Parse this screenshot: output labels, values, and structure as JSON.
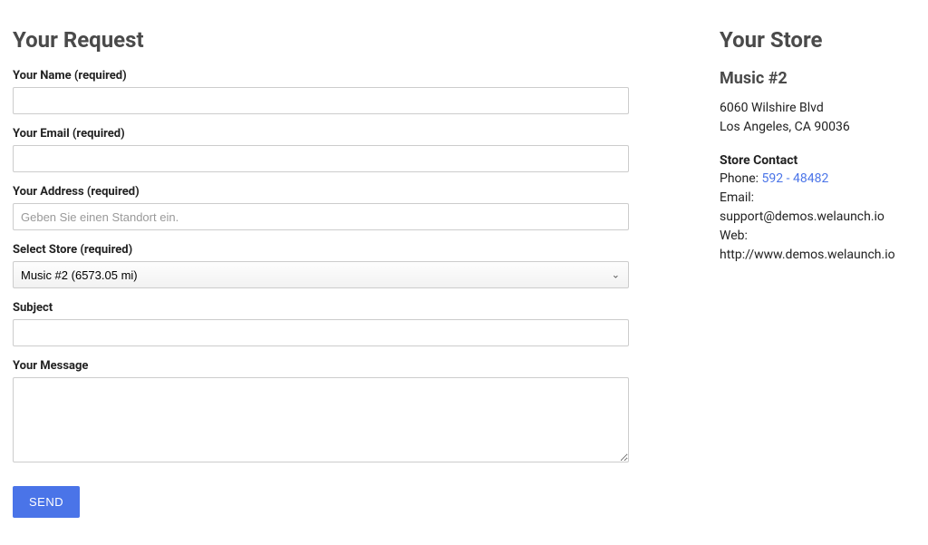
{
  "request": {
    "heading": "Your Request",
    "name": {
      "label": "Your Name (required)",
      "value": ""
    },
    "email": {
      "label": "Your Email (required)",
      "value": ""
    },
    "address": {
      "label": "Your Address (required)",
      "placeholder": "Geben Sie einen Standort ein.",
      "value": ""
    },
    "store": {
      "label": "Select Store (required)",
      "selected": "Music #2 (6573.05 mi)"
    },
    "subject": {
      "label": "Subject",
      "value": ""
    },
    "message": {
      "label": "Your Message",
      "value": ""
    },
    "submit_label": "SEND"
  },
  "store_panel": {
    "heading": "Your Store",
    "name": "Music #2",
    "address_line1": "6060 Wilshire Blvd",
    "address_line2": "Los Angeles, CA 90036",
    "contact_heading": "Store Contact",
    "phone_label": "Phone: ",
    "phone_value": "592 - 48482",
    "email_label": "Email: ",
    "email_value": "support@demos.welaunch.io",
    "web_label": "Web: ",
    "web_value": "http://www.demos.welaunch.io"
  }
}
